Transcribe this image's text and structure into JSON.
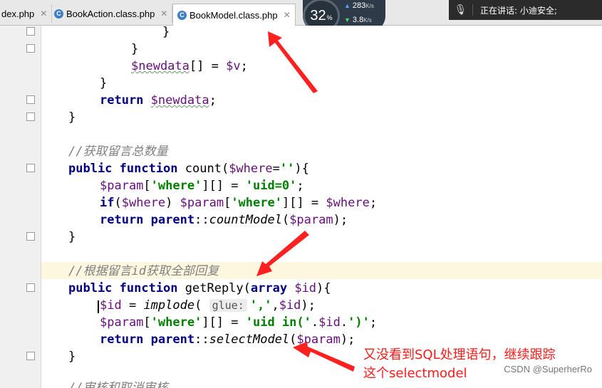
{
  "tabs": [
    {
      "label": "dex.php",
      "icon": "php-file-icon",
      "active": false
    },
    {
      "label": "BookAction.class.php",
      "icon": "class-file-icon",
      "active": false
    },
    {
      "label": "BookModel.class.php",
      "icon": "class-file-icon",
      "active": true
    }
  ],
  "tab_close": "✕",
  "net_widget": {
    "percent": "32",
    "percent_unit": "%",
    "upload": "283",
    "download": "3.8",
    "unit": "K/s"
  },
  "voice_bar": {
    "status": "正在讲话: 小迪安全;",
    "icon": "microphone-icon"
  },
  "code": {
    "l1": "}",
    "l2": "}",
    "l3_var": "$newdata",
    "l3_rest": "[] = ",
    "l3_v": "$v",
    "l3_end": ";",
    "l4": "}",
    "l5_kw": "return",
    "l5_var": "$newdata",
    "l5_end": ";",
    "l6": "}",
    "c1": "//获取留言总数量",
    "f1_kw": "public function",
    "f1_name": " count(",
    "f1_var": "$where",
    "f1_eq": "=",
    "f1_str": "''",
    "f1_end": "){",
    "f1_b1_var": "$param",
    "f1_b1_a": "[",
    "f1_b1_s1": "'where'",
    "f1_b1_b": "][] = ",
    "f1_b1_s2": "'uid=0'",
    "f1_b1_end": ";",
    "f1_b2_kw": "if",
    "f1_b2_a": "(",
    "f1_b2_v1": "$where",
    "f1_b2_b": ") ",
    "f1_b2_v2": "$param",
    "f1_b2_c": "[",
    "f1_b2_s": "'where'",
    "f1_b2_d": "][] = ",
    "f1_b2_v3": "$where",
    "f1_b2_end": ";",
    "f1_b3_kw1": "return",
    "f1_b3_kw2": "parent",
    "f1_b3_a": "::",
    "f1_b3_fn": "countModel",
    "f1_b3_b": "(",
    "f1_b3_v": "$param",
    "f1_b3_end": ");",
    "f1_close": "}",
    "c2": "//根据留言id获取全部回复",
    "f2_kw": "public function",
    "f2_name": " getReply(",
    "f2_kw2": "array",
    "f2_sp": " ",
    "f2_var": "$id",
    "f2_end": "){",
    "f2_b1_v": "$id",
    "f2_b1_a": " = ",
    "f2_b1_fn": "implode",
    "f2_b1_b": "( ",
    "f2_b1_hint": "glue:",
    "f2_b1_s": "','",
    "f2_b1_c": ",",
    "f2_b1_v2": "$id",
    "f2_b1_end": ");",
    "f2_b2_v": "$param",
    "f2_b2_a": "[",
    "f2_b2_s1": "'where'",
    "f2_b2_b": "][] = ",
    "f2_b2_s2": "'uid in('",
    "f2_b2_c": ".",
    "f2_b2_v2": "$id",
    "f2_b2_d": ".",
    "f2_b2_s3": "')'",
    "f2_b2_end": ";",
    "f2_b3_kw1": "return",
    "f2_b3_kw2": "parent",
    "f2_b3_a": "::",
    "f2_b3_fn": "selectModel",
    "f2_b3_b": "(",
    "f2_b3_v": "$param",
    "f2_b3_end": ");",
    "f2_close": "}",
    "c3": "//审核和取消审核"
  },
  "annotation": {
    "line1": "又没看到SQL处理语句，继续跟踪",
    "line2": "这个selectmodel"
  },
  "watermark": "CSDN @SuperherRo",
  "colors": {
    "annotation": "#ff1a1a",
    "keyword": "#000080",
    "variable": "#660e7a",
    "string": "#008000",
    "comment": "#808080",
    "highlight_line": "#fdf7e0"
  }
}
